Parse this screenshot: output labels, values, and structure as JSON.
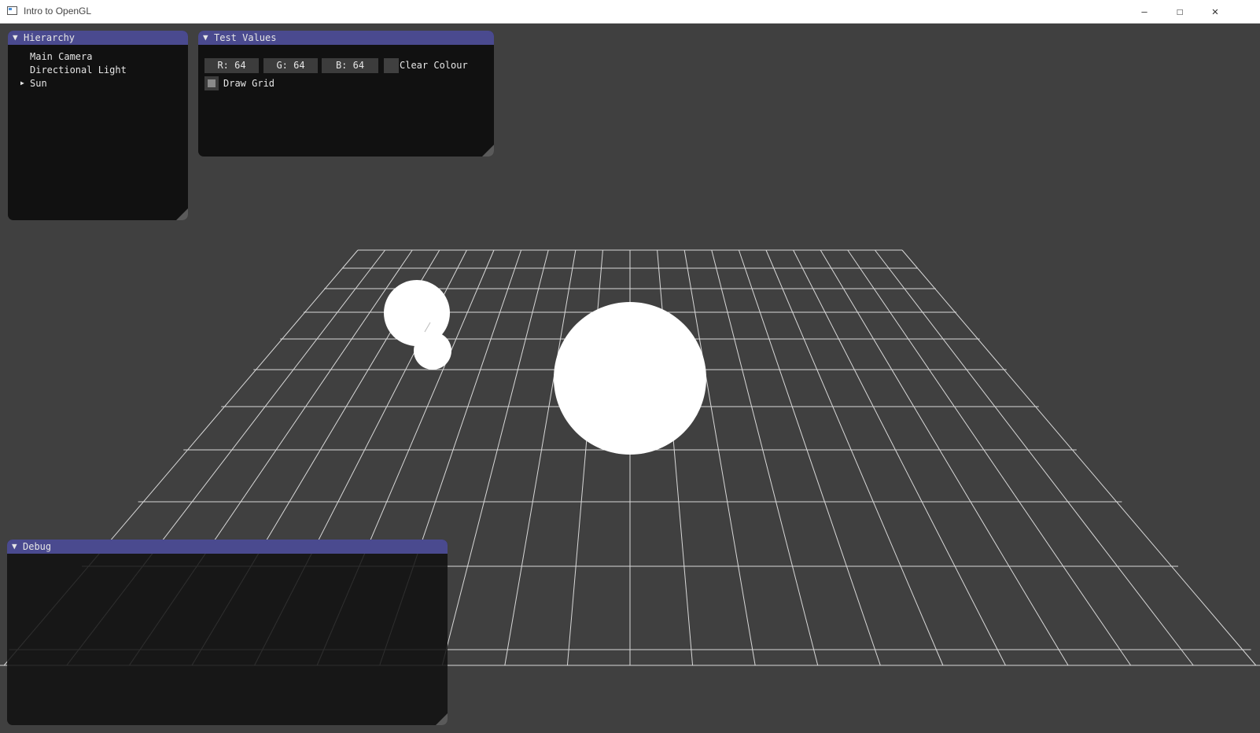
{
  "window": {
    "title": "Intro to OpenGL",
    "minimize_glyph": "—",
    "maximize_glyph": "☐",
    "close_glyph": "✕"
  },
  "hierarchy": {
    "title": "Hierarchy",
    "collapse_glyph": "▼",
    "expand_glyph": "▶",
    "items": [
      {
        "label": "Main Camera"
      },
      {
        "label": "Directional Light"
      },
      {
        "label": "Sun"
      }
    ]
  },
  "test_values": {
    "title": "Test Values",
    "collapse_glyph": "▼",
    "r_field": "R: 64",
    "g_field": "G: 64",
    "b_field": "B: 64",
    "clear_colour_label": "Clear Colour",
    "clear_colour_value": "#404040",
    "draw_grid_label": "Draw Grid",
    "draw_grid_checked": true
  },
  "debug": {
    "title": "Debug",
    "collapse_glyph": "▼"
  },
  "colors": {
    "background": "#404040",
    "panel_bg": "#111111",
    "panel_title_bg": "#4a4a8f",
    "field_bg": "#3c3c3c",
    "text": "#e6e6e6",
    "grid": "#d8d8d8",
    "objects": "#ffffff"
  },
  "icons": {
    "app": "window-icon",
    "minimize": "minimize-icon",
    "maximize": "maximize-icon",
    "close": "close-icon",
    "collapse": "triangle-down-icon",
    "expand": "triangle-right-icon",
    "resize": "resize-grip-icon"
  }
}
